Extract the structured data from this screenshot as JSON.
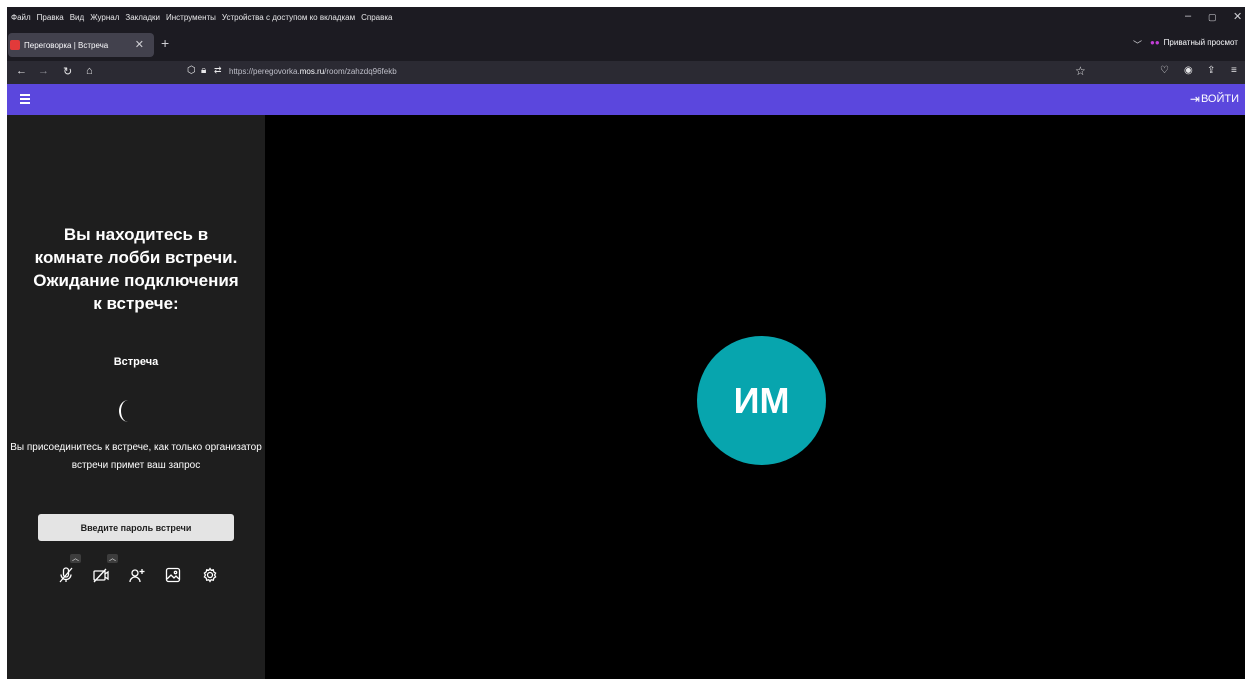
{
  "browser": {
    "menu": [
      "Файл",
      "Правка",
      "Вид",
      "Журнал",
      "Закладки",
      "Инструменты",
      "Устройства с доступом ко вкладкам",
      "Справка"
    ],
    "tab_title": "Переговорка | Встреча",
    "private_label": "Приватный просмот",
    "url_prefix": "https://peregovorka.",
    "url_host": "mos.ru",
    "url_path": "/room/zahzdq96fekb"
  },
  "header": {
    "login_label": "ВОЙТИ"
  },
  "lobby": {
    "title": "Вы находитесь в комнате лобби встречи. Ожидание подключения к встрече:",
    "meeting_name": "Встреча",
    "join_info": "Вы присоединитесь к встрече, как только организатор встречи примет ваш запрос",
    "password_button": "Введите пароль встречи"
  },
  "stage": {
    "avatar_initials": "ИМ"
  },
  "colors": {
    "accent": "#5b47dd",
    "avatar": "#07a5ae",
    "panel": "#1e1e1e",
    "stage": "#000000"
  },
  "icons": [
    "mic-off-icon",
    "camera-off-icon",
    "invite-user-icon",
    "background-image-icon",
    "settings-gear-icon",
    "login-icon",
    "menu-icon"
  ]
}
